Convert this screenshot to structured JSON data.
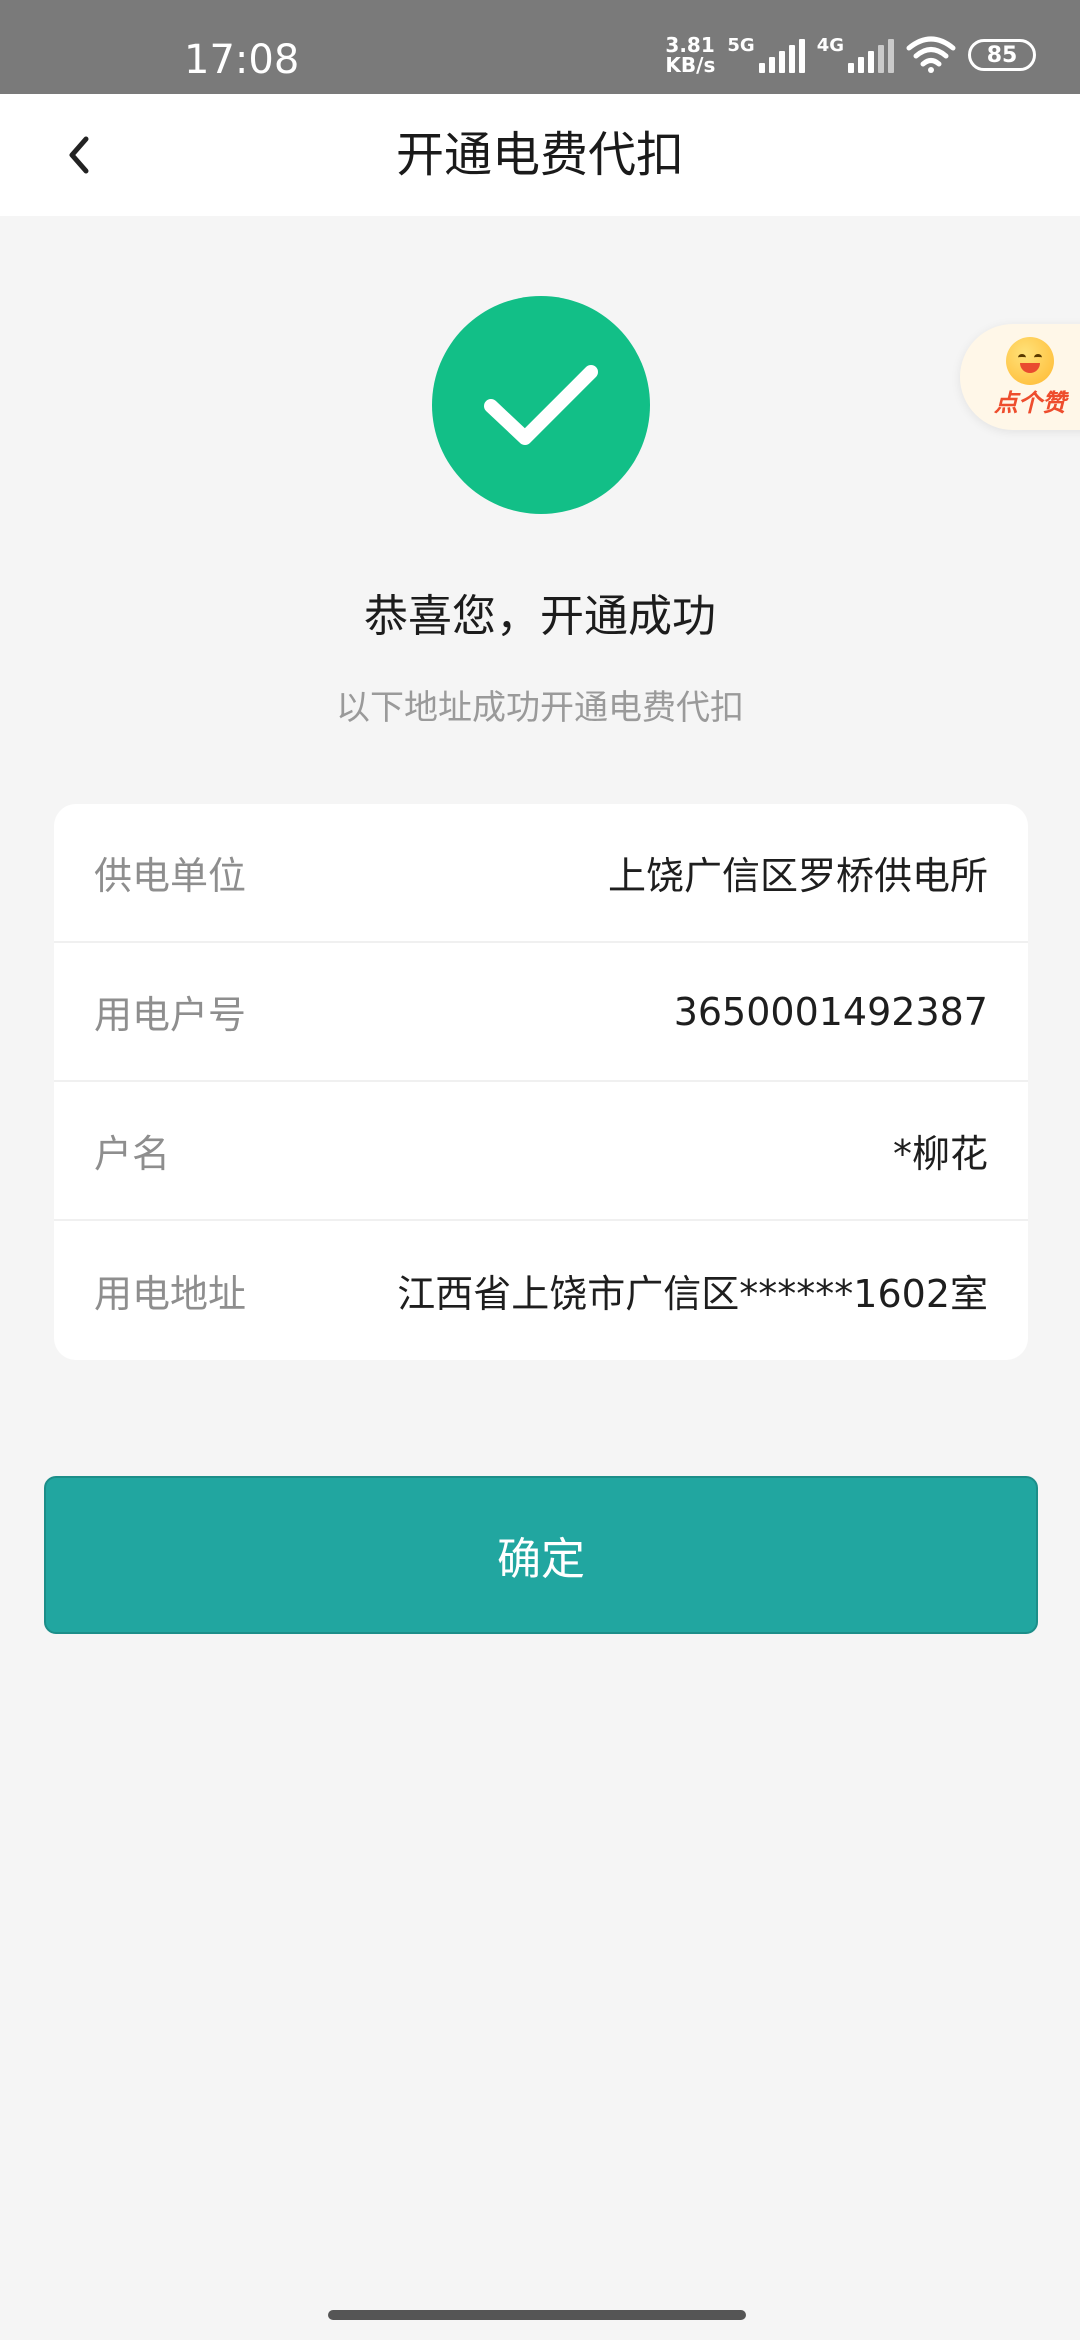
{
  "status_bar": {
    "time": "17:08",
    "speed_value": "3.81",
    "speed_unit": "KB/s",
    "network_1": "5G",
    "network_2": "4G",
    "battery": "85"
  },
  "header": {
    "title": "开通电费代扣"
  },
  "success": {
    "title": "恭喜您，开通成功",
    "subtitle": "以下地址成功开通电费代扣"
  },
  "like_float": {
    "label": "点个赞"
  },
  "info": {
    "rows": [
      {
        "label": "供电单位",
        "value": "上饶广信区罗桥供电所"
      },
      {
        "label": "用电户号",
        "value": "3650001492387"
      },
      {
        "label": "户名",
        "value": "*柳花"
      },
      {
        "label": "用电地址",
        "value": "江西省上饶市广信区******1602室"
      }
    ]
  },
  "actions": {
    "confirm_label": "确定"
  },
  "colors": {
    "success_green": "#12bf87",
    "confirm_teal": "#21a6a0",
    "status_bar_gray": "#7a7a7a"
  }
}
